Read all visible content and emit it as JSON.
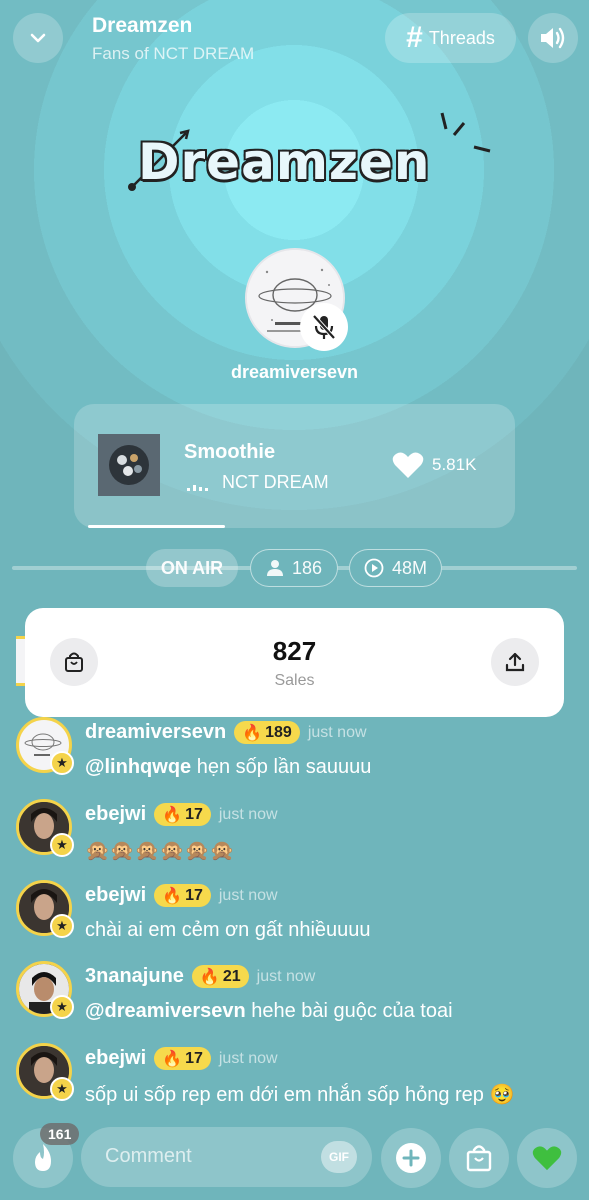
{
  "header": {
    "title": "Dreamzen",
    "subtitle": "Fans of NCT DREAM",
    "threads_label": "Threads",
    "back_icon": "chevron-down-icon",
    "sound_icon": "speaker-icon"
  },
  "banner": {
    "logo_text": "Dreamzen"
  },
  "host": {
    "name": "dreamiversevn",
    "mic_icon": "mic-off-icon"
  },
  "now_playing": {
    "song": "Smoothie",
    "artist": "NCT DREAM",
    "likes": "5.81K",
    "progress": 0.31
  },
  "stats": {
    "on_air_label": "ON AIR",
    "listeners": "186",
    "plays": "48M"
  },
  "sales": {
    "count": "827",
    "label": "Sales"
  },
  "messages": [
    {
      "user": "dreamiversevn",
      "badge": "189",
      "time": "just now",
      "mention": "@linhqwqe",
      "text": " hẹn sốp lần sauuuu"
    },
    {
      "user": "ebejwi",
      "badge": "17",
      "time": "just now",
      "mention": "",
      "text": "🙊🙊🙊🙊🙊🙊"
    },
    {
      "user": "ebejwi",
      "badge": "17",
      "time": "just now",
      "mention": "",
      "text": "chài ai em cẻm ơn gất nhiềuuuu"
    },
    {
      "user": "3nanajune",
      "badge": "21",
      "time": "just now",
      "mention": "@dreamiversevn",
      "text": " hehe bài guộc của toai"
    },
    {
      "user": "ebejwi",
      "badge": "17",
      "time": "just now",
      "mention": "",
      "text": "sốp ui sốp rep em dới em nhắn sốp hỏng rep 🥹"
    }
  ],
  "bottom_bar": {
    "fire_count": "161",
    "comment_placeholder": "Comment",
    "gif_label": "GIF"
  },
  "colors": {
    "background": "#6fb6bc",
    "badge": "#f6d94c",
    "heart_button": "#3fbf3f"
  }
}
